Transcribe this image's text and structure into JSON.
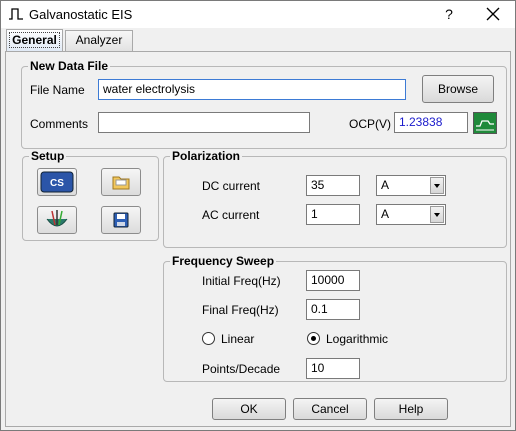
{
  "window": {
    "title": "Galvanostatic EIS",
    "help_label": "?",
    "close_label": "✕"
  },
  "tabs": [
    {
      "label": "General"
    },
    {
      "label": "Analyzer"
    }
  ],
  "new_data_file": {
    "title": "New Data File",
    "file_name_label": "File Name",
    "file_name_value": "water electrolysis",
    "browse_label": "Browse",
    "comments_label": "Comments",
    "comments_value": "",
    "ocp_label": "OCP(V)",
    "ocp_value": "1.23838"
  },
  "setup": {
    "title": "Setup",
    "icons": [
      "cs-device-icon",
      "open-folder-icon",
      "electrode-icon",
      "save-disk-icon"
    ],
    "cs_text": "CS"
  },
  "polarization": {
    "title": "Polarization",
    "dc_label": "DC current",
    "dc_value": "35",
    "dc_unit": "A",
    "ac_label": "AC current",
    "ac_value": "1",
    "ac_unit": "A"
  },
  "frequency_sweep": {
    "title": "Frequency Sweep",
    "initial_label": "Initial Freq(Hz)",
    "initial_value": "10000",
    "final_label": "Final Freq(Hz)",
    "final_value": "0.1",
    "linear_label": "Linear",
    "log_label": "Logarithmic",
    "selected": "Logarithmic",
    "points_label": "Points/Decade",
    "points_value": "10"
  },
  "buttons": {
    "ok": "OK",
    "cancel": "Cancel",
    "help": "Help"
  }
}
